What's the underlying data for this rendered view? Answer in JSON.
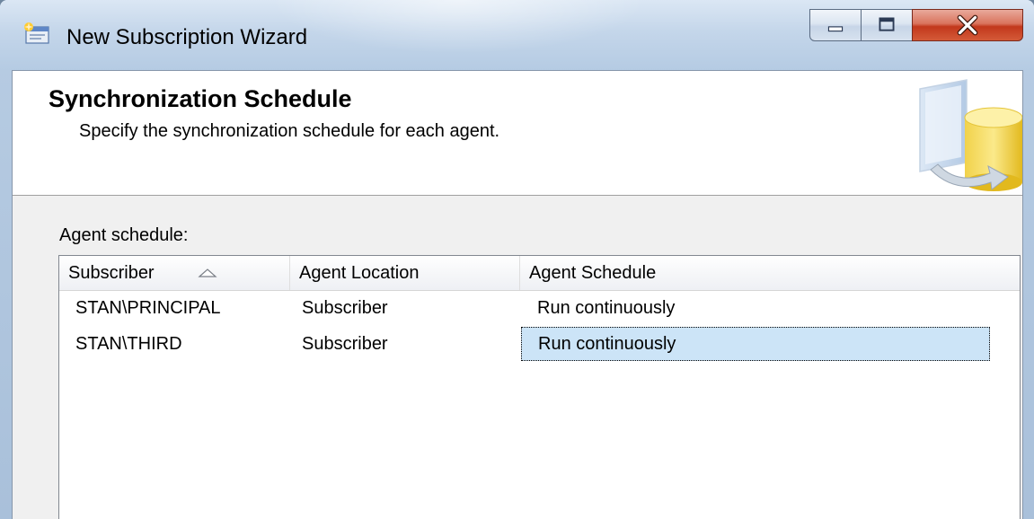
{
  "window": {
    "title": "New Subscription Wizard",
    "icons": {
      "app": "wizard-app-icon",
      "minimize": "minimize-icon",
      "maximize": "maximize-icon",
      "close": "close-icon"
    }
  },
  "header": {
    "title": "Synchronization Schedule",
    "subtitle": "Specify the synchronization schedule for each agent.",
    "graphic": "database-wizard-graphic"
  },
  "agent_schedule": {
    "label": "Agent schedule:",
    "columns": [
      "Subscriber",
      "Agent Location",
      "Agent Schedule"
    ],
    "sort_column": "Subscriber",
    "sort_direction": "ascending",
    "rows": [
      {
        "subscriber": "STAN\\PRINCIPAL",
        "location": "Subscriber",
        "schedule": "Run continuously"
      },
      {
        "subscriber": "STAN\\THIRD",
        "location": "Subscriber",
        "schedule": "Run continuously"
      }
    ],
    "selected_row": 1
  },
  "colors": {
    "selection": "#cce4f7",
    "close_button": "#c2381c",
    "title_bar": "#c4d6ea"
  }
}
